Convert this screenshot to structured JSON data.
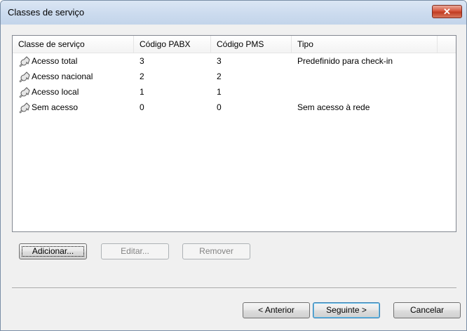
{
  "window": {
    "title": "Classes de serviço",
    "close_glyph": "✕"
  },
  "list": {
    "columns": [
      "Classe de serviço",
      "Código PABX",
      "Código PMS",
      "Tipo"
    ],
    "rows": [
      {
        "icon": "wrench-icon",
        "name": "Acesso total",
        "pabx": "3",
        "pms": "3",
        "tipo": "Predefinido para check-in"
      },
      {
        "icon": "wrench-icon",
        "name": "Acesso nacional",
        "pabx": "2",
        "pms": "2",
        "tipo": ""
      },
      {
        "icon": "wrench-icon",
        "name": "Acesso local",
        "pabx": "1",
        "pms": "1",
        "tipo": ""
      },
      {
        "icon": "wrench-icon",
        "name": "Sem acesso",
        "pabx": "0",
        "pms": "0",
        "tipo": "Sem acesso à rede"
      }
    ]
  },
  "buttons": {
    "add": "Adicionar...",
    "edit": "Editar...",
    "remove": "Remover",
    "back": "< Anterior",
    "next": "Seguinte >",
    "cancel": "Cancelar"
  },
  "colors": {
    "title_bar": "#cddcef",
    "close_button": "#c94a30",
    "default_button_border": "#3c7fb1"
  }
}
